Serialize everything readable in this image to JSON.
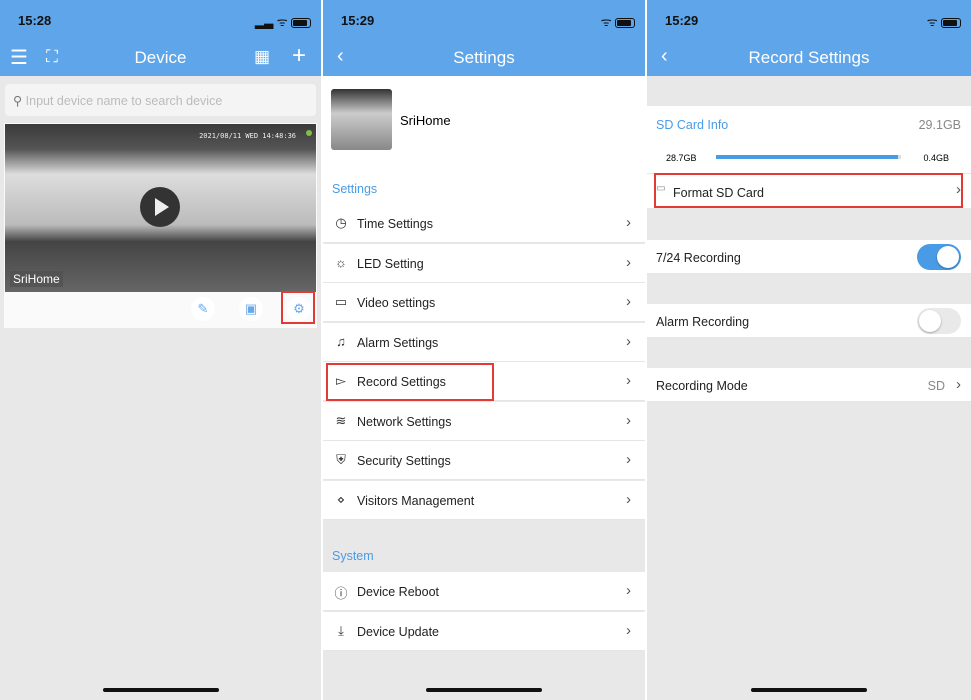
{
  "device_screen": {
    "time": "15:28",
    "title": "Device",
    "search_placeholder": "Input device name to search device",
    "camera": {
      "name": "SriHome",
      "timestamp": "2021/08/11  WED 14:48:36",
      "online_color": "#7bc043"
    },
    "icons": [
      "menu-icon",
      "scan-icon",
      "grid-icon",
      "plus-icon",
      "edit-icon",
      "playback-icon",
      "gear-icon"
    ]
  },
  "settings_screen": {
    "time": "15:29",
    "title": "Settings",
    "device_name": "SriHome",
    "section_settings": "Settings",
    "items": [
      {
        "label": "Time Settings",
        "icon": "clock-icon"
      },
      {
        "label": "LED Setting",
        "icon": "bulb-icon"
      },
      {
        "label": "Video settings",
        "icon": "video-icon"
      },
      {
        "label": "Alarm Settings",
        "icon": "bell-icon"
      },
      {
        "label": "Record Settings",
        "icon": "camera-icon"
      },
      {
        "label": "Network Settings",
        "icon": "wifi-icon"
      },
      {
        "label": "Security Settings",
        "icon": "shield-icon"
      },
      {
        "label": "Visitors Management",
        "icon": "share-icon"
      }
    ],
    "section_system": "System",
    "system_items": [
      {
        "label": "Device Reboot",
        "icon": "info-icon"
      },
      {
        "label": "Device Update",
        "icon": "download-icon"
      }
    ]
  },
  "record_screen": {
    "time": "15:29",
    "title": "Record Settings",
    "sd_card_info": "SD Card Info",
    "sd_total": "29.1GB",
    "sd_free": "28.7GB",
    "sd_used": "0.4GB",
    "sd_free_percent": 98.6,
    "format_label": "Format SD Card",
    "recording_724": {
      "label": "7/24 Recording",
      "on": true
    },
    "alarm_recording": {
      "label": "Alarm Recording",
      "on": false
    },
    "recording_mode": {
      "label": "Recording Mode",
      "value": "SD"
    }
  },
  "colors": {
    "header": "#5ea5ea",
    "accent": "#4a9be6",
    "highlight": "#e53935"
  }
}
